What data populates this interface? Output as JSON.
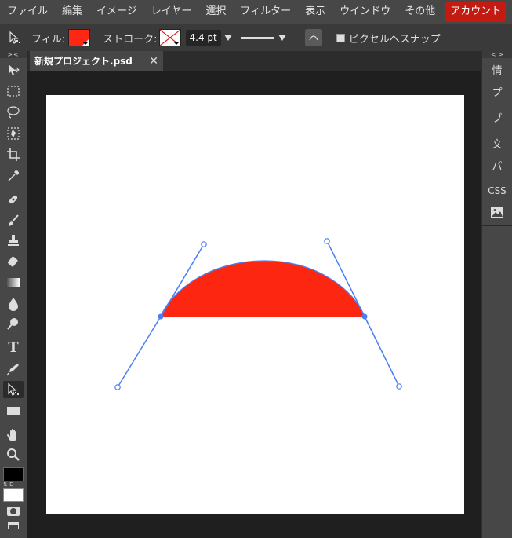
{
  "menu": {
    "items": [
      "ファイル",
      "編集",
      "イメージ",
      "レイヤー",
      "選択",
      "フィルター",
      "表示",
      "ウインドウ",
      "その他"
    ],
    "account": "アカウント"
  },
  "options": {
    "fill_label": "フィル:",
    "fill_color": "#ff2714",
    "stroke_label": "ストローク:",
    "stroke_width": "4.4 pt",
    "snap_label": "ピクセルへスナップ"
  },
  "document": {
    "tab_name": "新規プロジェクト.psd"
  },
  "colors": {
    "shape_fill": "#fd2711",
    "path_stroke": "#4a7ef5",
    "foreground": "#000000",
    "background": "#ffffff"
  },
  "right_panel": {
    "items": [
      "情",
      "プ",
      "ブ",
      "文",
      "パ",
      "CSS"
    ]
  },
  "tools": [
    "path-select-icon",
    "marquee-icon",
    "lasso-icon",
    "quick-select-icon",
    "crop-icon",
    "eyedropper-icon",
    "healing-icon",
    "brush-icon",
    "stamp-icon",
    "eraser-icon",
    "gradient-icon",
    "blur-icon",
    "dodge-icon",
    "type-icon",
    "pen-icon",
    "direct-select-icon",
    "rectangle-icon",
    "hand-icon",
    "zoom-icon"
  ]
}
